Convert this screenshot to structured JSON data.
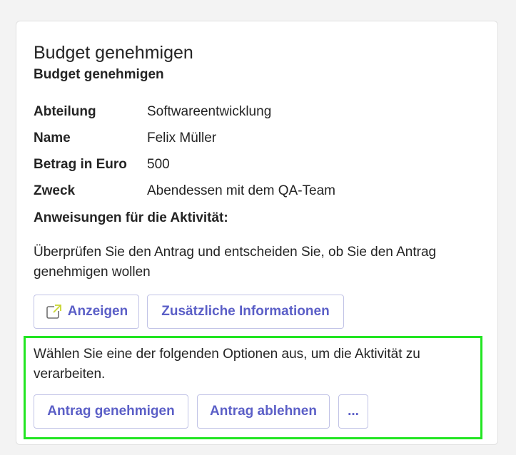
{
  "card": {
    "title": "Budget genehmigen",
    "subtitle": "Budget genehmigen"
  },
  "facts": [
    {
      "key": "Abteilung",
      "value": "Softwareentwicklung"
    },
    {
      "key": "Name",
      "value": "Felix Müller"
    },
    {
      "key": "Betrag in Euro",
      "value": "500"
    },
    {
      "key": "Zweck",
      "value": "Abendessen mit dem QA-Team"
    }
  ],
  "instructions": {
    "heading": "Anweisungen für die Aktivität:",
    "text": "Überprüfen Sie den Antrag und entscheiden Sie, ob Sie den Antrag genehmigen wollen"
  },
  "actions": {
    "view_label": "Anzeigen",
    "view_icon": "open-external-icon",
    "info_label": "Zusätzliche Informationen"
  },
  "options": {
    "text": "Wählen Sie eine der folgenden Optionen aus, um die Aktivität zu verarbeiten.",
    "approve_label": "Antrag genehmigen",
    "reject_label": "Antrag ablehnen",
    "more_label": "..."
  },
  "colors": {
    "accent": "#5b5fc7",
    "highlight": "#22e522",
    "card_bg": "#ffffff",
    "page_bg": "#f3f3f3"
  }
}
